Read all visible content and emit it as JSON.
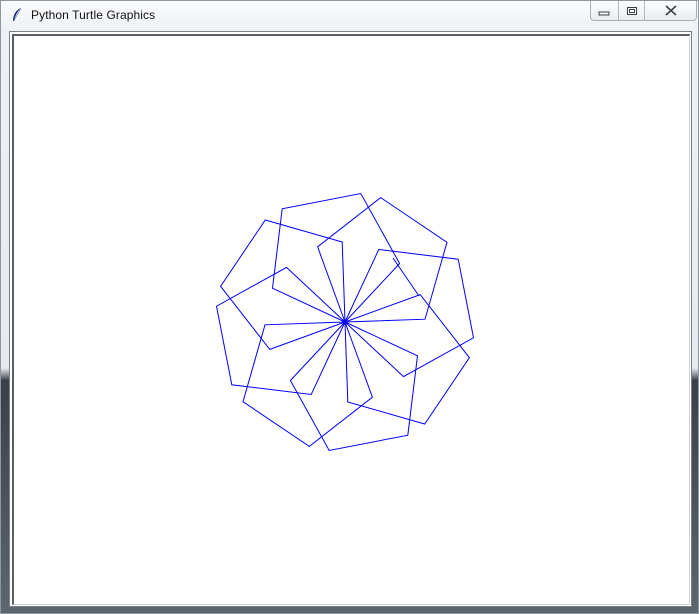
{
  "window": {
    "title": "Python Turtle Graphics",
    "icon": "feather-icon",
    "controls": [
      {
        "name": "minimize-button",
        "icon": "minimize-icon"
      },
      {
        "name": "maximize-button",
        "icon": "maximize-icon"
      },
      {
        "name": "close-button",
        "icon": "close-icon"
      }
    ]
  },
  "canvas": {
    "background": "#ffffff",
    "pen_color": "#0000ff",
    "pattern": {
      "shape": "pentagon",
      "repetitions": 8,
      "side_length": 80,
      "rotation_per_repetition_deg": 45
    }
  }
}
